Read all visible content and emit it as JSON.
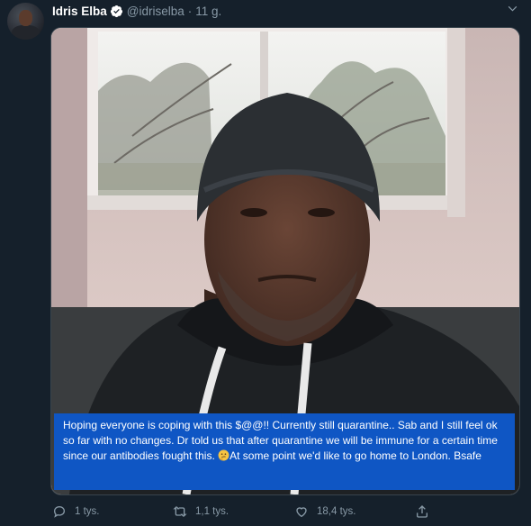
{
  "tweet": {
    "author_name": "Idris Elba",
    "author_handle": "@idriselba",
    "separator": "·",
    "time": "11 g.",
    "caption": {
      "text_before_emoji": "Hoping everyone is coping with this $@@!!  Currently still quarantine.. Sab and I still feel ok so far with no changes. Dr told us that after quarantine we will be immune for a certain time since our antibodies fought this. ",
      "emoji": "thinking-face",
      "text_after_emoji": "At some point  we'd like to go home to London. Bsafe"
    },
    "actions": {
      "replies": "1 tys.",
      "retweets": "1,1 tys.",
      "likes": "18,4 tys."
    }
  },
  "icons": [
    "verified-badge-icon",
    "chevron-down-icon",
    "reply-icon",
    "retweet-icon",
    "heart-icon",
    "share-icon",
    "thinking-face-emoji"
  ],
  "colors": {
    "background": "#15202b",
    "text_primary": "#ffffff",
    "text_secondary": "#8899a6",
    "accent": "#1da1f2",
    "caption_background": "#0f56c4"
  }
}
